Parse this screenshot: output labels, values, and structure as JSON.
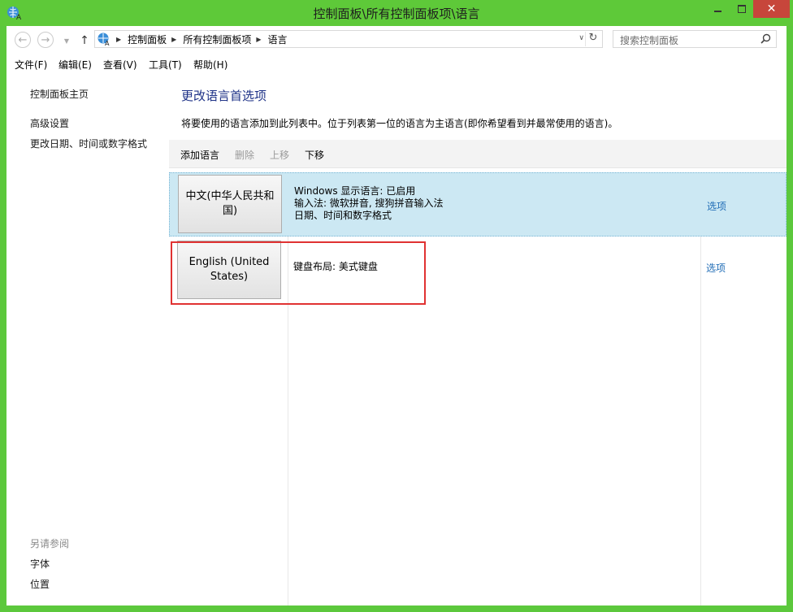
{
  "window": {
    "title": "控制面板\\所有控制面板项\\语言",
    "close_glyph": "✕"
  },
  "nav": {
    "back_glyph": "←",
    "forward_glyph": "→",
    "up_glyph": "↑",
    "breadcrumb": [
      "控制面板",
      "所有控制面板项",
      "语言"
    ],
    "search_placeholder": "搜索控制面板"
  },
  "menu": [
    "文件(F)",
    "编辑(E)",
    "查看(V)",
    "工具(T)",
    "帮助(H)"
  ],
  "sidebar": {
    "links": [
      "控制面板主页",
      "高级设置",
      "更改日期、时间或数字格式"
    ],
    "see_also_heading": "另请参阅",
    "see_also_links": [
      "字体",
      "位置"
    ]
  },
  "main": {
    "title": "更改语言首选项",
    "description": "将要使用的语言添加到此列表中。位于列表第一位的语言为主语言(即你希望看到并最常使用的语言)。",
    "toolbar": {
      "add": "添加语言",
      "remove": "删除",
      "up": "上移",
      "down": "下移"
    },
    "languages": [
      {
        "name": "中文(中华人民共和国)",
        "details": [
          "Windows 显示语言: 已启用",
          "输入法: 微软拼音, 搜狗拼音输入法",
          "日期、时间和数字格式"
        ],
        "options": "选项",
        "selected": true
      },
      {
        "name": "English (United States)",
        "details": [
          "键盘布局: 美式键盘"
        ],
        "options": "选项",
        "selected": false
      }
    ]
  },
  "colors": {
    "titlebar": "#5ec939",
    "close_button": "#c7463b",
    "title_blue": "#1e3287",
    "link_blue": "#1f6cb6",
    "selected_row": "#cce8f3",
    "highlight_box": "#e03232"
  }
}
